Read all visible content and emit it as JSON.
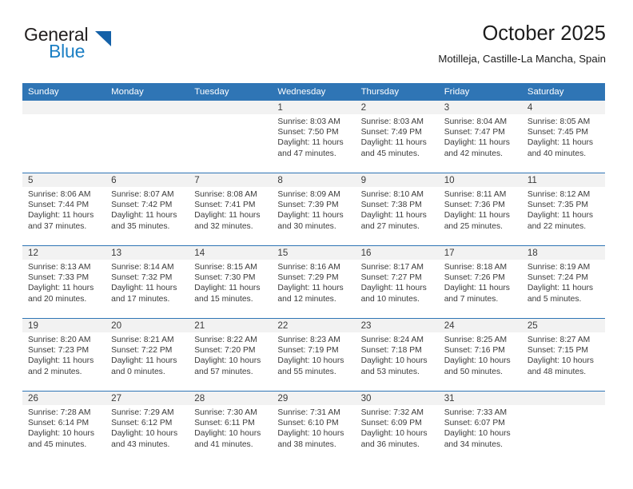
{
  "brand": {
    "name_top": "General",
    "name_bottom": "Blue",
    "triangle_icon": "brand-triangle-icon",
    "color_dark": "#221f1f",
    "color_blue": "#1b7fc4",
    "color_triangle": "#1461a8"
  },
  "header": {
    "title": "October 2025",
    "subtitle": "Motilleja, Castille-La Mancha, Spain"
  },
  "theme": {
    "header_blue": "#2f75b5",
    "daynum_band": "#f2f2f2",
    "text": "#3b3b3b"
  },
  "weekdays": [
    "Sunday",
    "Monday",
    "Tuesday",
    "Wednesday",
    "Thursday",
    "Friday",
    "Saturday"
  ],
  "weeks": [
    [
      {
        "day": ""
      },
      {
        "day": ""
      },
      {
        "day": ""
      },
      {
        "day": "1",
        "sunrise": "Sunrise: 8:03 AM",
        "sunset": "Sunset: 7:50 PM",
        "daylight1": "Daylight: 11 hours",
        "daylight2": "and 47 minutes."
      },
      {
        "day": "2",
        "sunrise": "Sunrise: 8:03 AM",
        "sunset": "Sunset: 7:49 PM",
        "daylight1": "Daylight: 11 hours",
        "daylight2": "and 45 minutes."
      },
      {
        "day": "3",
        "sunrise": "Sunrise: 8:04 AM",
        "sunset": "Sunset: 7:47 PM",
        "daylight1": "Daylight: 11 hours",
        "daylight2": "and 42 minutes."
      },
      {
        "day": "4",
        "sunrise": "Sunrise: 8:05 AM",
        "sunset": "Sunset: 7:45 PM",
        "daylight1": "Daylight: 11 hours",
        "daylight2": "and 40 minutes."
      }
    ],
    [
      {
        "day": "5",
        "sunrise": "Sunrise: 8:06 AM",
        "sunset": "Sunset: 7:44 PM",
        "daylight1": "Daylight: 11 hours",
        "daylight2": "and 37 minutes."
      },
      {
        "day": "6",
        "sunrise": "Sunrise: 8:07 AM",
        "sunset": "Sunset: 7:42 PM",
        "daylight1": "Daylight: 11 hours",
        "daylight2": "and 35 minutes."
      },
      {
        "day": "7",
        "sunrise": "Sunrise: 8:08 AM",
        "sunset": "Sunset: 7:41 PM",
        "daylight1": "Daylight: 11 hours",
        "daylight2": "and 32 minutes."
      },
      {
        "day": "8",
        "sunrise": "Sunrise: 8:09 AM",
        "sunset": "Sunset: 7:39 PM",
        "daylight1": "Daylight: 11 hours",
        "daylight2": "and 30 minutes."
      },
      {
        "day": "9",
        "sunrise": "Sunrise: 8:10 AM",
        "sunset": "Sunset: 7:38 PM",
        "daylight1": "Daylight: 11 hours",
        "daylight2": "and 27 minutes."
      },
      {
        "day": "10",
        "sunrise": "Sunrise: 8:11 AM",
        "sunset": "Sunset: 7:36 PM",
        "daylight1": "Daylight: 11 hours",
        "daylight2": "and 25 minutes."
      },
      {
        "day": "11",
        "sunrise": "Sunrise: 8:12 AM",
        "sunset": "Sunset: 7:35 PM",
        "daylight1": "Daylight: 11 hours",
        "daylight2": "and 22 minutes."
      }
    ],
    [
      {
        "day": "12",
        "sunrise": "Sunrise: 8:13 AM",
        "sunset": "Sunset: 7:33 PM",
        "daylight1": "Daylight: 11 hours",
        "daylight2": "and 20 minutes."
      },
      {
        "day": "13",
        "sunrise": "Sunrise: 8:14 AM",
        "sunset": "Sunset: 7:32 PM",
        "daylight1": "Daylight: 11 hours",
        "daylight2": "and 17 minutes."
      },
      {
        "day": "14",
        "sunrise": "Sunrise: 8:15 AM",
        "sunset": "Sunset: 7:30 PM",
        "daylight1": "Daylight: 11 hours",
        "daylight2": "and 15 minutes."
      },
      {
        "day": "15",
        "sunrise": "Sunrise: 8:16 AM",
        "sunset": "Sunset: 7:29 PM",
        "daylight1": "Daylight: 11 hours",
        "daylight2": "and 12 minutes."
      },
      {
        "day": "16",
        "sunrise": "Sunrise: 8:17 AM",
        "sunset": "Sunset: 7:27 PM",
        "daylight1": "Daylight: 11 hours",
        "daylight2": "and 10 minutes."
      },
      {
        "day": "17",
        "sunrise": "Sunrise: 8:18 AM",
        "sunset": "Sunset: 7:26 PM",
        "daylight1": "Daylight: 11 hours",
        "daylight2": "and 7 minutes."
      },
      {
        "day": "18",
        "sunrise": "Sunrise: 8:19 AM",
        "sunset": "Sunset: 7:24 PM",
        "daylight1": "Daylight: 11 hours",
        "daylight2": "and 5 minutes."
      }
    ],
    [
      {
        "day": "19",
        "sunrise": "Sunrise: 8:20 AM",
        "sunset": "Sunset: 7:23 PM",
        "daylight1": "Daylight: 11 hours",
        "daylight2": "and 2 minutes."
      },
      {
        "day": "20",
        "sunrise": "Sunrise: 8:21 AM",
        "sunset": "Sunset: 7:22 PM",
        "daylight1": "Daylight: 11 hours",
        "daylight2": "and 0 minutes."
      },
      {
        "day": "21",
        "sunrise": "Sunrise: 8:22 AM",
        "sunset": "Sunset: 7:20 PM",
        "daylight1": "Daylight: 10 hours",
        "daylight2": "and 57 minutes."
      },
      {
        "day": "22",
        "sunrise": "Sunrise: 8:23 AM",
        "sunset": "Sunset: 7:19 PM",
        "daylight1": "Daylight: 10 hours",
        "daylight2": "and 55 minutes."
      },
      {
        "day": "23",
        "sunrise": "Sunrise: 8:24 AM",
        "sunset": "Sunset: 7:18 PM",
        "daylight1": "Daylight: 10 hours",
        "daylight2": "and 53 minutes."
      },
      {
        "day": "24",
        "sunrise": "Sunrise: 8:25 AM",
        "sunset": "Sunset: 7:16 PM",
        "daylight1": "Daylight: 10 hours",
        "daylight2": "and 50 minutes."
      },
      {
        "day": "25",
        "sunrise": "Sunrise: 8:27 AM",
        "sunset": "Sunset: 7:15 PM",
        "daylight1": "Daylight: 10 hours",
        "daylight2": "and 48 minutes."
      }
    ],
    [
      {
        "day": "26",
        "sunrise": "Sunrise: 7:28 AM",
        "sunset": "Sunset: 6:14 PM",
        "daylight1": "Daylight: 10 hours",
        "daylight2": "and 45 minutes."
      },
      {
        "day": "27",
        "sunrise": "Sunrise: 7:29 AM",
        "sunset": "Sunset: 6:12 PM",
        "daylight1": "Daylight: 10 hours",
        "daylight2": "and 43 minutes."
      },
      {
        "day": "28",
        "sunrise": "Sunrise: 7:30 AM",
        "sunset": "Sunset: 6:11 PM",
        "daylight1": "Daylight: 10 hours",
        "daylight2": "and 41 minutes."
      },
      {
        "day": "29",
        "sunrise": "Sunrise: 7:31 AM",
        "sunset": "Sunset: 6:10 PM",
        "daylight1": "Daylight: 10 hours",
        "daylight2": "and 38 minutes."
      },
      {
        "day": "30",
        "sunrise": "Sunrise: 7:32 AM",
        "sunset": "Sunset: 6:09 PM",
        "daylight1": "Daylight: 10 hours",
        "daylight2": "and 36 minutes."
      },
      {
        "day": "31",
        "sunrise": "Sunrise: 7:33 AM",
        "sunset": "Sunset: 6:07 PM",
        "daylight1": "Daylight: 10 hours",
        "daylight2": "and 34 minutes."
      },
      {
        "day": ""
      }
    ]
  ]
}
